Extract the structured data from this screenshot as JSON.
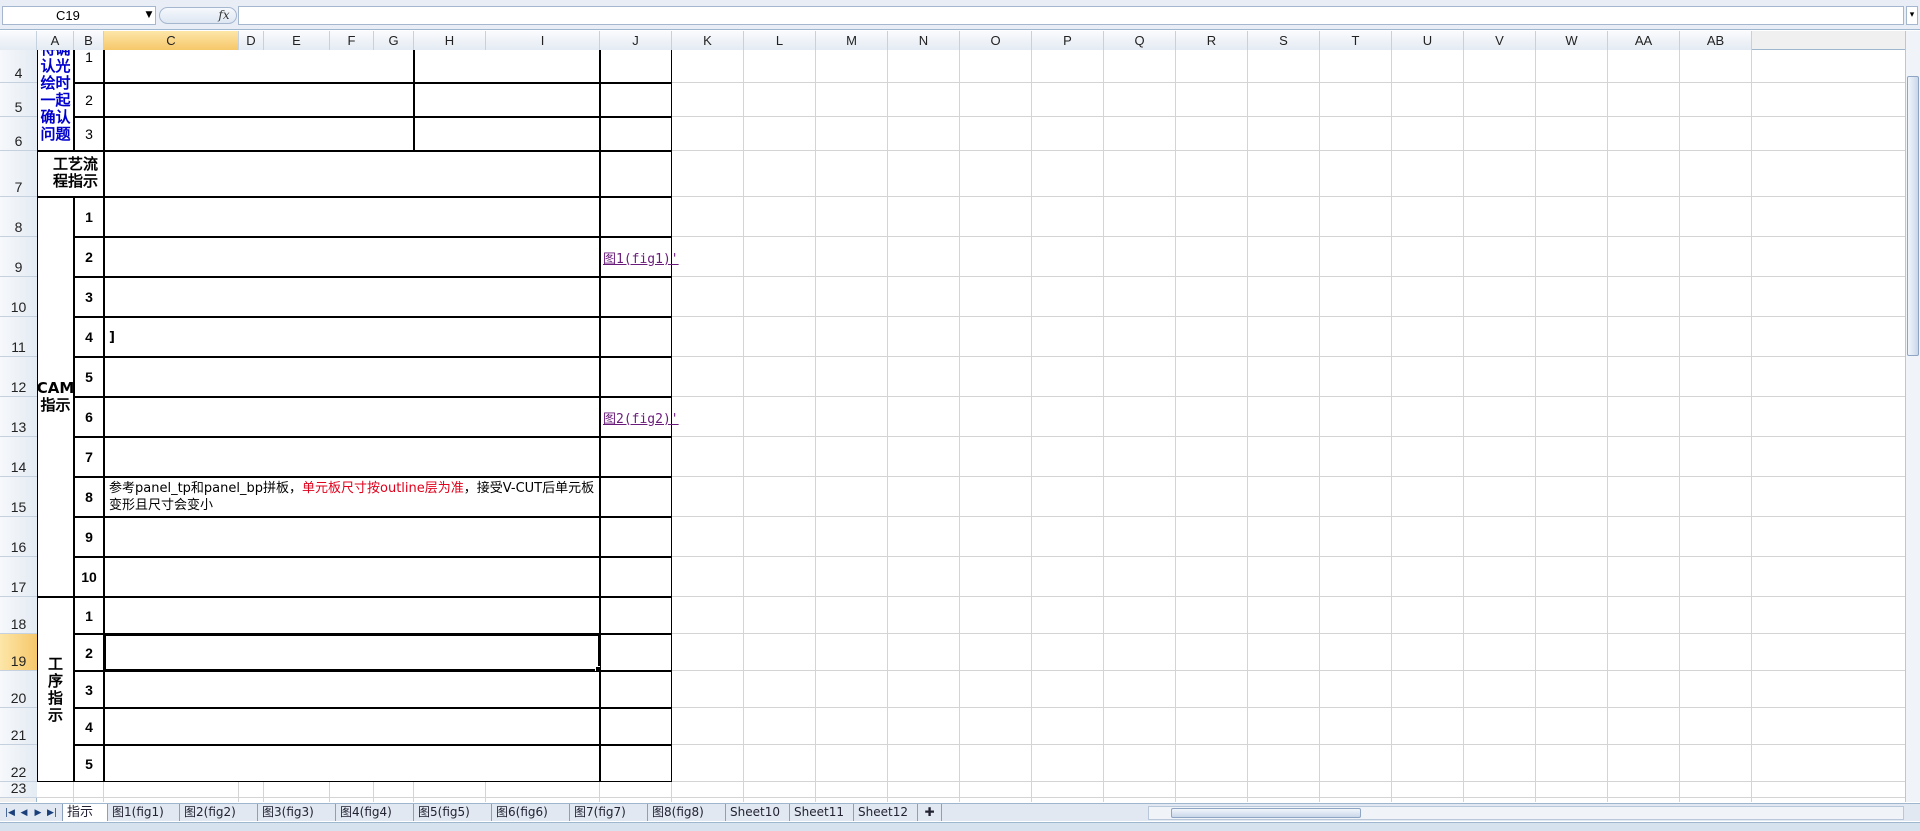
{
  "formula_bar": {
    "name_box": "C19",
    "fx_label": "fx",
    "formula": ""
  },
  "columns": [
    "A",
    "B",
    "C",
    "D",
    "E",
    "F",
    "G",
    "H",
    "I",
    "J",
    "K",
    "L",
    "M",
    "N",
    "O",
    "P",
    "Q",
    "R",
    "S",
    "T",
    "U",
    "V",
    "W",
    "AA",
    "AB"
  ],
  "rows": [
    "4",
    "5",
    "6",
    "7",
    "8",
    "9",
    "10",
    "11",
    "12",
    "13",
    "14",
    "15",
    "16",
    "17",
    "18",
    "19",
    "20",
    "21",
    "22",
    "23"
  ],
  "selected_cell": {
    "column": "C",
    "row": "19"
  },
  "sections": {
    "confirm": {
      "label": "待确认光绘时一起确认问题",
      "items": [
        "1",
        "2",
        "3"
      ]
    },
    "process": {
      "label": "工艺流程指示"
    },
    "cam": {
      "label": "CAM指示",
      "items": [
        "1",
        "2",
        "3",
        "4",
        "5",
        "6",
        "7",
        "8",
        "9",
        "10"
      ],
      "row4_text": "]",
      "row8_text_prefix": "参考panel_tp和panel_bp拼板，",
      "row8_text_red": "单元板尺寸按outline层为准",
      "row8_text_suffix": "，接受V-CUT后单元板变形且尺寸会变小",
      "fig1_link": "图1(fig1)'",
      "fig2_link": "图2(fig2)'"
    },
    "procedure": {
      "label": "工序指示",
      "items": [
        "1",
        "2",
        "3",
        "4",
        "5"
      ]
    }
  },
  "sheet_tabs": [
    "指示",
    "图1(fig1)",
    "图2(fig2)",
    "图3(fig3)",
    "图4(fig4)",
    "图5(fig5)",
    "图6(fig6)",
    "图7(fig7)",
    "图8(fig8)",
    "Sheet10",
    "Sheet11",
    "Sheet12"
  ],
  "active_tab": "指示"
}
